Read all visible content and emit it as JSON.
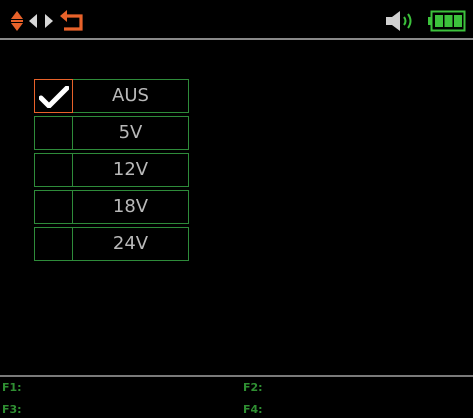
{
  "top_bar": {
    "icons": {
      "nav_up_down": "up-down-arrows-icon",
      "nav_left": "left-arrow-icon",
      "nav_right": "right-arrow-icon",
      "nav_back": "return-arrow-icon",
      "speaker": "speaker-icon",
      "battery": "battery-icon"
    },
    "battery_level": 1.0
  },
  "options": [
    {
      "label": "AUS",
      "checked": true
    },
    {
      "label": "5V",
      "checked": false
    },
    {
      "label": "12V",
      "checked": false
    },
    {
      "label": "18V",
      "checked": false
    },
    {
      "label": "24V",
      "checked": false
    }
  ],
  "function_keys": {
    "f1": "F1:",
    "f2": "F2:",
    "f3": "F3:",
    "f4": "F4:"
  },
  "colors": {
    "accent_orange": "#e8622a",
    "frame_green": "#2e8b3a",
    "fkey_green": "#2f8f32",
    "battery_green": "#3cc23c",
    "label_gray": "#b9b9b9",
    "background": "#000000"
  }
}
